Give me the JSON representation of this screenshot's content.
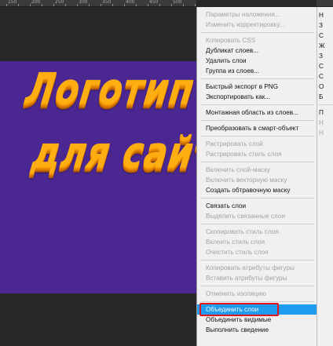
{
  "ruler": {
    "labels": [
      "150",
      "200",
      "250",
      "300",
      "350",
      "400",
      "450",
      "500"
    ]
  },
  "canvas": {
    "background_color": "#282828",
    "artboard_color": "#4b2792",
    "logo_text_color": "#ffae12",
    "logo_line_1": "Логотип",
    "logo_line_2": "для сайта"
  },
  "context_menu": {
    "items": [
      {
        "label": "Параметры наложения...",
        "enabled": false
      },
      {
        "label": "Изменить корректировку...",
        "enabled": false
      },
      {
        "separator": true
      },
      {
        "label": "Копировать CSS",
        "enabled": false
      },
      {
        "label": "Дубликат слоев...",
        "enabled": true
      },
      {
        "label": "Удалить слои",
        "enabled": true
      },
      {
        "label": "Группа из слоев...",
        "enabled": true
      },
      {
        "separator": true
      },
      {
        "label": "Быстрый экспорт в PNG",
        "enabled": true
      },
      {
        "label": "Экспортировать как...",
        "enabled": true
      },
      {
        "separator": true
      },
      {
        "label": "Монтажная область из слоев...",
        "enabled": true
      },
      {
        "separator": true
      },
      {
        "label": "Преобразовать в смарт-объект",
        "enabled": true
      },
      {
        "separator": true
      },
      {
        "label": "Растрировать слой",
        "enabled": false
      },
      {
        "label": "Растрировать стиль слоя",
        "enabled": false
      },
      {
        "separator": true
      },
      {
        "label": "Включить слой-маску",
        "enabled": false
      },
      {
        "label": "Включить векторную маску",
        "enabled": false
      },
      {
        "label": "Создать обтравочную маску",
        "enabled": true
      },
      {
        "separator": true
      },
      {
        "label": "Связать слои",
        "enabled": true
      },
      {
        "label": "Выделить связанные слои",
        "enabled": false
      },
      {
        "separator": true
      },
      {
        "label": "Скопировать стиль слоя",
        "enabled": false
      },
      {
        "label": "Вклеить стиль слоя",
        "enabled": false
      },
      {
        "label": "Очистить стиль слоя",
        "enabled": false
      },
      {
        "separator": true
      },
      {
        "label": "Копировать атрибуты фигуры",
        "enabled": false
      },
      {
        "label": "Вставить атрибуты фигуры",
        "enabled": false
      },
      {
        "separator": true
      },
      {
        "label": "Отменить изоляцию",
        "enabled": false
      },
      {
        "separator": true
      },
      {
        "label": "Объединить слои",
        "enabled": true,
        "highlighted": true
      },
      {
        "label": "Объединить видимые",
        "enabled": true
      },
      {
        "label": "Выполнить сведение",
        "enabled": true
      }
    ],
    "highlight_color": "#1f9bf0",
    "callout_box_color": "#e0181e"
  },
  "side_panel": {
    "items": [
      {
        "label": "Н",
        "enabled": true
      },
      {
        "label": "З",
        "enabled": true
      },
      {
        "label": "С",
        "enabled": true
      },
      {
        "label": "Ж",
        "enabled": true
      },
      {
        "label": "З",
        "enabled": true
      },
      {
        "label": "С",
        "enabled": true
      },
      {
        "label": "С",
        "enabled": true
      },
      {
        "label": "О",
        "enabled": true
      },
      {
        "label": "Б",
        "enabled": true
      },
      {
        "separator": true
      },
      {
        "label": "П",
        "enabled": true
      },
      {
        "label": "Н",
        "enabled": false
      },
      {
        "label": "Н",
        "enabled": false
      }
    ]
  }
}
